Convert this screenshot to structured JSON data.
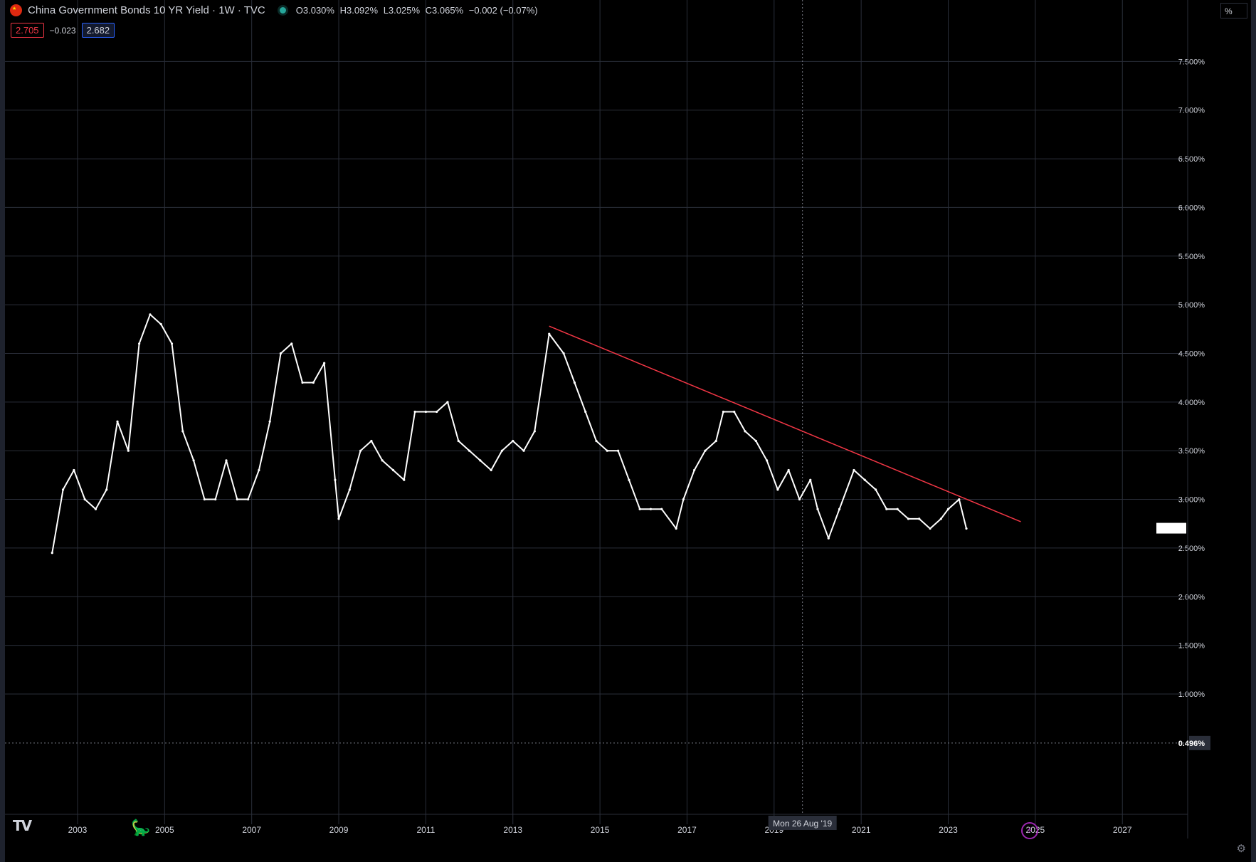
{
  "header": {
    "title": "China Government Bonds 10 YR Yield · 1W · TVC",
    "open": "O3.030%",
    "high": "H3.092%",
    "low": "L3.025%",
    "close": "C3.065%",
    "change": "−0.002 (−0.07%)",
    "bid": "2.705",
    "spread": "−0.023",
    "ask": "2.682"
  },
  "scale_button": "%",
  "crosshair": {
    "date_label": "Mon 26 Aug '19",
    "price_label": "0.496%",
    "date": "2019-08-26",
    "price": 0.496
  },
  "colors": {
    "background": "#000000",
    "grid": "#2a2e39",
    "series": "#ffffff",
    "trendline": "#f23645",
    "crosshair_label_bg": "#2a2e39",
    "accent_red": "#f23645",
    "accent_blue": "#2962ff"
  },
  "icons": {
    "flag": "china-flag-icon",
    "status": "market-status-dot-icon",
    "logo": "tradingview-logo-icon",
    "replay": "dinosaur-icon",
    "alert": "lightning-icon",
    "settings": "gear-icon"
  },
  "chart_data": {
    "type": "line",
    "title": "China Government Bonds 10 YR Yield · 1W · TVC",
    "xlabel": "",
    "ylabel": "",
    "xlim": [
      "2001-05-01",
      "2028-07-01"
    ],
    "ylim": [
      0.1,
      8.0
    ],
    "x_ticks": [
      "2003",
      "2005",
      "2007",
      "2009",
      "2011",
      "2013",
      "2015",
      "2017",
      "2019",
      "2021",
      "2023",
      "2025",
      "2027"
    ],
    "y_ticks": [
      "7.500%",
      "7.000%",
      "6.500%",
      "6.000%",
      "5.500%",
      "5.000%",
      "4.500%",
      "4.000%",
      "3.500%",
      "3.000%",
      "2.500%",
      "2.000%",
      "1.500%",
      "1.000%"
    ],
    "y_tick_values": [
      7.5,
      7.0,
      6.5,
      6.0,
      5.5,
      5.0,
      4.5,
      4.0,
      3.5,
      3.0,
      2.5,
      2.0,
      1.5,
      1.0
    ],
    "grid": true,
    "series": [
      {
        "x": [
          "2002-06",
          "2002-09",
          "2002-12",
          "2003-03",
          "2003-06",
          "2003-09",
          "2003-12",
          "2004-03",
          "2004-06",
          "2004-09",
          "2004-12",
          "2005-03",
          "2005-06",
          "2005-09",
          "2005-12",
          "2006-03",
          "2006-06",
          "2006-09",
          "2006-12",
          "2007-03",
          "2007-06",
          "2007-09",
          "2007-12",
          "2008-03",
          "2008-06",
          "2008-09",
          "2008-12",
          "2009-01",
          "2009-04",
          "2009-07",
          "2009-10",
          "2010-01",
          "2010-04",
          "2010-07",
          "2010-10",
          "2011-01",
          "2011-04",
          "2011-07",
          "2011-10",
          "2012-01",
          "2012-04",
          "2012-07",
          "2012-10",
          "2013-01",
          "2013-04",
          "2013-07",
          "2013-11",
          "2014-03",
          "2014-06",
          "2014-09",
          "2014-12",
          "2015-03",
          "2015-06",
          "2015-09",
          "2015-12",
          "2016-03",
          "2016-06",
          "2016-10",
          "2016-12",
          "2017-03",
          "2017-06",
          "2017-09",
          "2017-11",
          "2018-02",
          "2018-05",
          "2018-08",
          "2018-11",
          "2019-02",
          "2019-05",
          "2019-08",
          "2019-11",
          "2020-01",
          "2020-04",
          "2020-07",
          "2020-11",
          "2021-02",
          "2021-05",
          "2021-08",
          "2021-11",
          "2022-02",
          "2022-05",
          "2022-08",
          "2022-11",
          "2023-01",
          "2023-04",
          "2023-06"
        ],
        "values": [
          2.45,
          3.1,
          3.3,
          3.0,
          2.9,
          3.1,
          3.8,
          3.5,
          4.6,
          4.9,
          4.8,
          4.6,
          3.7,
          3.4,
          3.0,
          3.0,
          3.4,
          3.0,
          3.0,
          3.3,
          3.8,
          4.5,
          4.6,
          4.2,
          4.2,
          4.4,
          3.2,
          2.8,
          3.1,
          3.5,
          3.6,
          3.4,
          3.3,
          3.2,
          3.9,
          3.9,
          3.9,
          4.0,
          3.6,
          3.5,
          3.4,
          3.3,
          3.5,
          3.6,
          3.5,
          3.7,
          4.7,
          4.5,
          4.2,
          3.9,
          3.6,
          3.5,
          3.5,
          3.2,
          2.9,
          2.9,
          2.9,
          2.7,
          3.0,
          3.3,
          3.5,
          3.6,
          3.9,
          3.9,
          3.7,
          3.6,
          3.4,
          3.1,
          3.3,
          3.0,
          3.2,
          2.9,
          2.6,
          2.9,
          3.3,
          3.2,
          3.1,
          2.9,
          2.9,
          2.8,
          2.8,
          2.7,
          2.8,
          2.9,
          3.0,
          2.7
        ]
      }
    ],
    "trendline": {
      "start": {
        "x": "2013-11-01",
        "y": 4.78
      },
      "end": {
        "x": "2024-09-01",
        "y": 2.77
      }
    }
  }
}
